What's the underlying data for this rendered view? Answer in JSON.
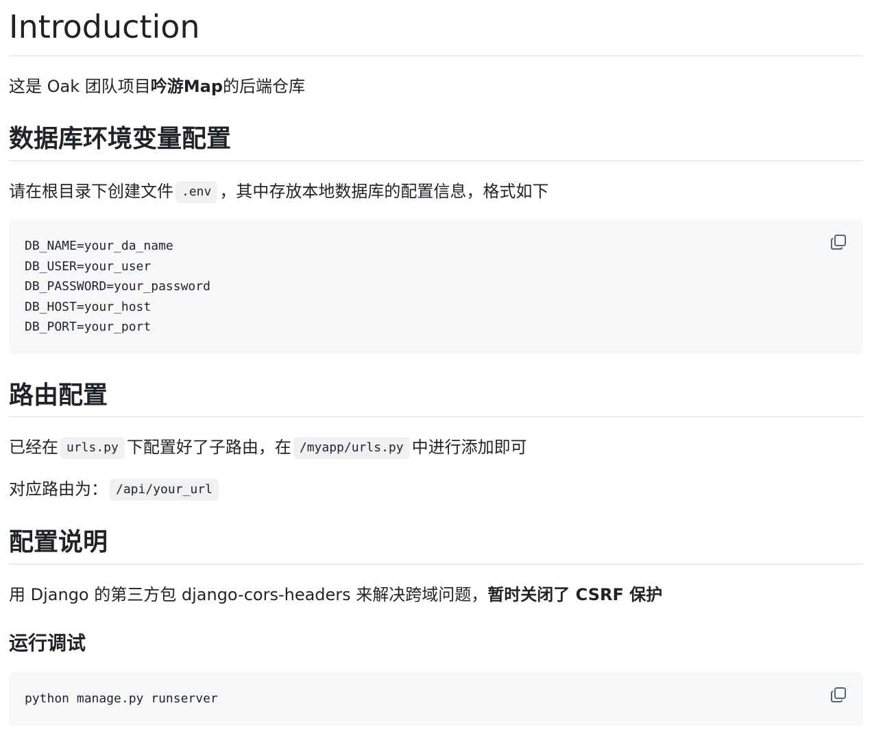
{
  "headings": {
    "intro": "Introduction",
    "db_env": "数据库环境变量配置",
    "routing": "路由配置",
    "config_notes": "配置说明",
    "run_debug": "运行调试"
  },
  "intro": {
    "prefix": "这是 Oak 团队项目",
    "project_bold": "吟游Map",
    "suffix": "的后端仓库"
  },
  "db_env": {
    "text_before": "请在根目录下创建文件",
    "file_code": ".env",
    "text_after": "，其中存放本地数据库的配置信息，格式如下",
    "code_lines": [
      "DB_NAME=your_da_name",
      "DB_USER=your_user",
      "DB_PASSWORD=your_password",
      "DB_HOST=your_host",
      "DB_PORT=your_port"
    ],
    "copy_icon": "copy-icon"
  },
  "routing": {
    "line1_a": "已经在",
    "line1_code1": "urls.py",
    "line1_b": "下配置好了子路由，在",
    "line1_code2": "/myapp/urls.py",
    "line1_c": "中进行添加即可",
    "line2_a": "对应路由为：",
    "line2_code": "/api/your_url"
  },
  "config_notes": {
    "text": "用 Django 的第三方包 django-cors-headers 来解决跨域问题，",
    "bold": "暂时关闭了 CSRF 保护"
  },
  "run_debug": {
    "code_lines": [
      "python manage.py runserver"
    ],
    "copy_icon": "copy-icon"
  }
}
